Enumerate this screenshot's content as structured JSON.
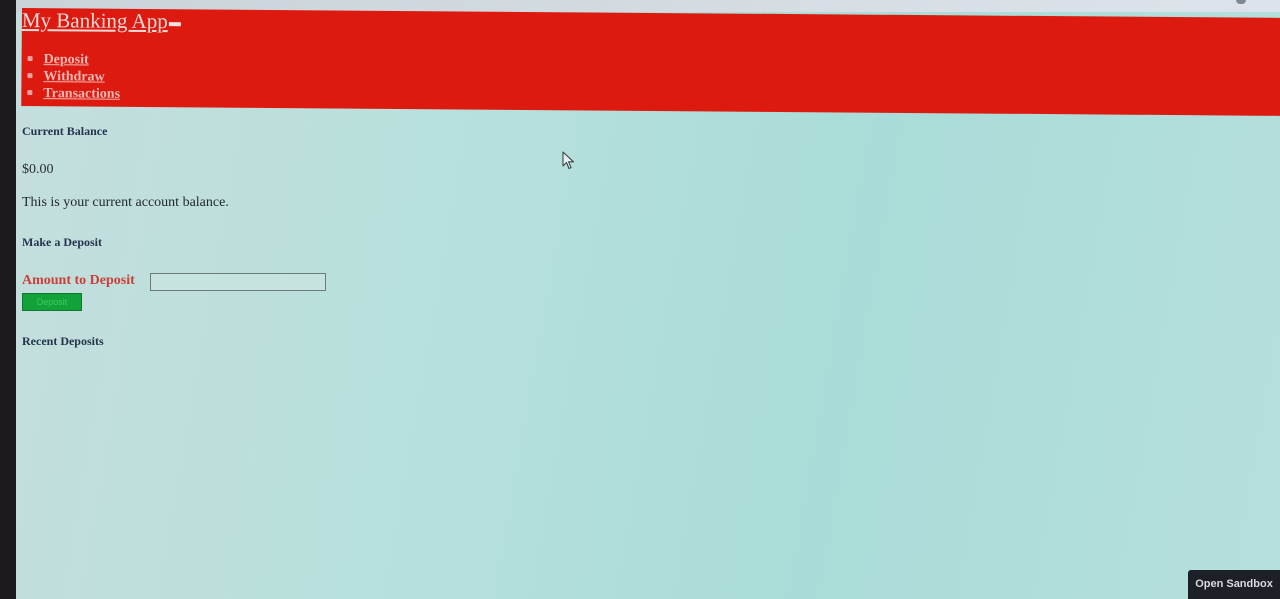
{
  "app": {
    "title": "My Banking App"
  },
  "nav": {
    "items": [
      {
        "label": "Deposit"
      },
      {
        "label": "Withdraw"
      },
      {
        "label": "Transactions"
      }
    ]
  },
  "balance_section": {
    "heading": "Current Balance",
    "amount": "$0.00",
    "description": "This is your current account balance."
  },
  "deposit_section": {
    "heading": "Make a Deposit",
    "amount_label": "Amount to Deposit",
    "amount_value": "",
    "button_label": "Deposit"
  },
  "recent_section": {
    "heading": "Recent Deposits"
  },
  "sandbox": {
    "button_label": "Open Sandbox"
  },
  "colors": {
    "header_bg": "#dd1a10",
    "page_bg": "#b7e0dc",
    "deposit_button": "#13a23a",
    "label_red": "#c9403a"
  },
  "icons": {
    "cursor": "mouse-pointer-icon"
  }
}
